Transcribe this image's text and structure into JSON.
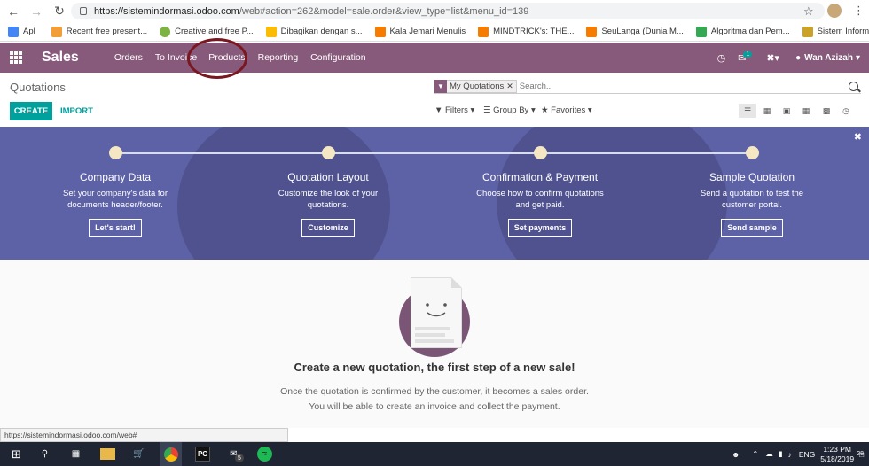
{
  "browser": {
    "url_host": "https://sistemindormasi.odoo.com",
    "url_path": "/web#action=262&model=sale.order&view_type=list&menu_id=139"
  },
  "bookmarks": [
    {
      "label": "Apl",
      "color": "#4285f4"
    },
    {
      "label": "Recent free present...",
      "color": "#f29d38"
    },
    {
      "label": "Creative and free P...",
      "color": "#7cb342"
    },
    {
      "label": "Dibagikan dengan s...",
      "color": "#fbbc05"
    },
    {
      "label": "Kala Jemari Menulis",
      "color": "#f57c00"
    },
    {
      "label": "MINDTRICK's: THE...",
      "color": "#f57c00"
    },
    {
      "label": "SeuLanga (Dunia M...",
      "color": "#f57c00"
    },
    {
      "label": "Algoritma dan Pem...",
      "color": "#34a853"
    },
    {
      "label": "Sistem Informasi M...",
      "color": "#c9a227"
    }
  ],
  "navbar": {
    "app_name": "Sales",
    "menu": [
      "Orders",
      "To Invoice",
      "Products",
      "Reporting",
      "Configuration"
    ],
    "messages_count": "1",
    "user_name": "Wan Azizah"
  },
  "control": {
    "breadcrumb": "Quotations",
    "facet_label": "My Quotations",
    "search_placeholder": "Search...",
    "create_label": "CREATE",
    "import_label": "IMPORT",
    "filters_label": "Filters",
    "groupby_label": "Group By",
    "favorites_label": "Favorites"
  },
  "banner": {
    "steps": [
      {
        "title": "Company Data",
        "desc1": "Set your company's data for",
        "desc2": "documents header/footer.",
        "button": "Let's start!"
      },
      {
        "title": "Quotation Layout",
        "desc1": "Customize the look of your",
        "desc2": "quotations.",
        "button": "Customize"
      },
      {
        "title": "Confirmation & Payment",
        "desc1": "Choose how to confirm quotations",
        "desc2": "and get paid.",
        "button": "Set payments"
      },
      {
        "title": "Sample Quotation",
        "desc1": "Send a quotation to test the",
        "desc2": "customer portal.",
        "button": "Send sample"
      }
    ]
  },
  "empty_state": {
    "title": "Create a new quotation, the first step of a new sale!",
    "line1": "Once the quotation is confirmed by the customer, it becomes a sales order.",
    "line2": "You will be able to create an invoice and collect the payment."
  },
  "status_url": "https://sistemindormasi.odoo.com/web#",
  "taskbar": {
    "mail_badge": "5",
    "language": "ENG",
    "time": "1:23 PM",
    "date": "5/18/2019",
    "notif_count": "28"
  },
  "colors": {
    "brand": "#875a7b",
    "accent": "#00a09d",
    "banner": "#5d61a6",
    "annotation": "#7a1720"
  }
}
